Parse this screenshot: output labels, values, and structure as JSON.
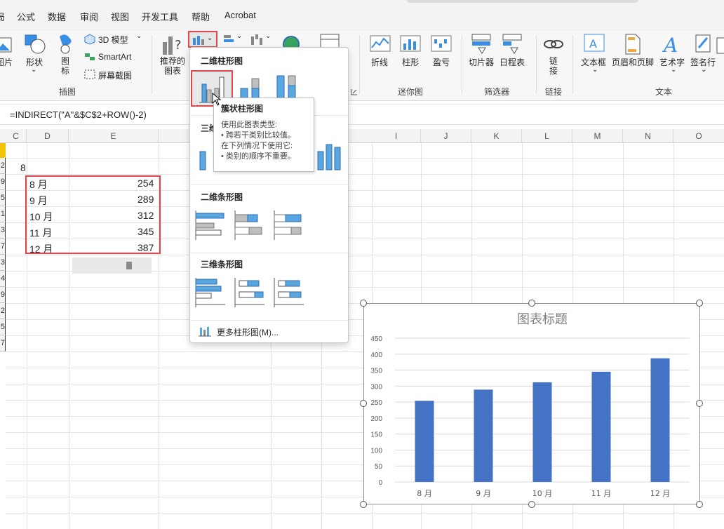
{
  "menu": {
    "items": [
      "局",
      "公式",
      "数据",
      "审阅",
      "视图",
      "开发工具",
      "帮助",
      "Acrobat"
    ]
  },
  "ribbon": {
    "illustrations": {
      "picture_label": "图片",
      "shapes_label": "形状",
      "icons_label": "图标",
      "model3d_label": "3D 模型",
      "smartart_label": "SmartArt",
      "screenshot_label": "屏幕截图",
      "group_label": "插图"
    },
    "charts": {
      "recommended_label": "推荐的图表"
    },
    "sparklines": {
      "line_label": "折线",
      "column_label": "柱形",
      "winloss_label": "盈亏",
      "group_label": "迷你图"
    },
    "filters": {
      "slicer_label": "切片器",
      "timeline_label": "日程表",
      "group_label": "筛选器"
    },
    "links": {
      "link_label": "链接",
      "group_label": "链接"
    },
    "text": {
      "textbox_label": "文本框",
      "header_footer_label": "页眉和页脚",
      "wordart_label": "艺术字",
      "signature_label": "签名行",
      "group_label": "文本"
    }
  },
  "formula_bar": {
    "formula": "=INDIRECT(\"A\"&$C$2+ROW()-2)"
  },
  "columns": [
    "C",
    "D",
    "E",
    "I",
    "J",
    "K",
    "L",
    "M",
    "N",
    "O"
  ],
  "rows": [
    "2",
    "9",
    "5",
    "1",
    "3",
    "7",
    "3",
    "4",
    "9",
    "2",
    "5",
    "7"
  ],
  "cells": {
    "c2": "8",
    "data": [
      {
        "month": "8 月",
        "value": "254"
      },
      {
        "month": "9 月",
        "value": "289"
      },
      {
        "month": "10 月",
        "value": "312"
      },
      {
        "month": "11 月",
        "value": "345"
      },
      {
        "month": "12 月",
        "value": "387"
      }
    ]
  },
  "dropdown": {
    "section_2d_column": "二维柱形图",
    "section_3d_column_partial": "三维",
    "section_2d_bar": "二维条形图",
    "section_3d_bar": "三维条形图",
    "more_charts": "更多柱形图(M)..."
  },
  "tooltip": {
    "title": "簇状柱形图",
    "line1": "使用此图表类型:",
    "line2": "• 跨若干类别比较值。",
    "line3": "在下列情况下使用它:",
    "line4": "• 类别的顺序不重要。"
  },
  "colors": {
    "accent_red": "#e0474c",
    "bar_blue": "#4472c4",
    "thumb_blue": "#5aa7e0"
  },
  "chart_data": {
    "type": "bar",
    "title": "图表标题",
    "categories": [
      "8 月",
      "9 月",
      "10 月",
      "11 月",
      "12 月"
    ],
    "values": [
      254,
      289,
      312,
      345,
      387
    ],
    "ylim": [
      0,
      450
    ],
    "yticks": [
      "0",
      "50",
      "100",
      "150",
      "200",
      "250",
      "300",
      "350",
      "400",
      "450"
    ],
    "grid": true,
    "legend": "none"
  }
}
